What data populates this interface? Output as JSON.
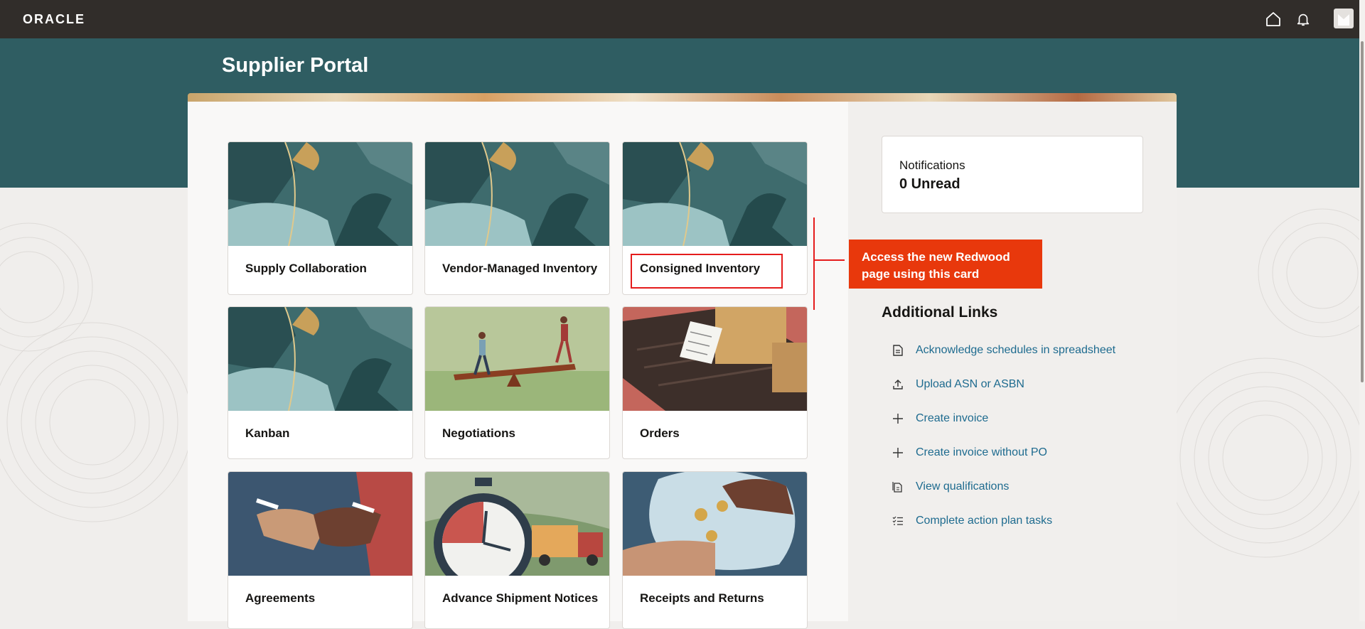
{
  "header": {
    "logo": "ORACLE",
    "icons": [
      "home-icon",
      "bell-icon",
      "user-avatar"
    ]
  },
  "page": {
    "title": "Supplier Portal"
  },
  "cards": [
    {
      "label": "Supply Collaboration"
    },
    {
      "label": "Vendor-Managed Inventory"
    },
    {
      "label": "Consigned Inventory"
    },
    {
      "label": "Kanban"
    },
    {
      "label": "Negotiations"
    },
    {
      "label": "Orders"
    },
    {
      "label": "Agreements"
    },
    {
      "label": "Advance Shipment Notices"
    },
    {
      "label": "Receipts and Returns"
    }
  ],
  "notifications": {
    "title": "Notifications",
    "count": "0 Unread"
  },
  "callout": {
    "text": "Access the new Redwood page using this card"
  },
  "additional_links": {
    "title": "Additional Links",
    "items": [
      {
        "label": "Acknowledge schedules in spreadsheet",
        "icon": "document-icon"
      },
      {
        "label": "Upload ASN or ASBN",
        "icon": "upload-icon"
      },
      {
        "label": "Create invoice",
        "icon": "plus-icon"
      },
      {
        "label": "Create invoice without PO",
        "icon": "plus-icon"
      },
      {
        "label": "View qualifications",
        "icon": "documents-icon"
      },
      {
        "label": "Complete action plan tasks",
        "icon": "checklist-icon"
      }
    ]
  },
  "colors": {
    "topbar": "#312d2a",
    "banner": "#2f5d62",
    "link": "#1e6b8f",
    "callout": "#e8380c",
    "highlight": "#e51c1c"
  }
}
